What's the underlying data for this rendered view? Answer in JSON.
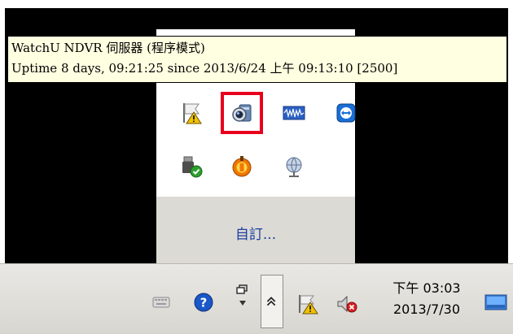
{
  "tooltip": {
    "line1": "WatchU NDVR 伺服器 (程序模式)",
    "line2": "Uptime 8 days, 09:21:25 since 2013/6/24 上午 09:13:10 [2500]"
  },
  "overflow_panel": {
    "customize_label": "自訂..."
  },
  "tray_icons": [
    "flag-warning-icon",
    "webcam-icon",
    "audio-wave-icon",
    "teamviewer-icon",
    "usb-safely-remove-icon",
    "orange-app-icon",
    "network-globe-icon"
  ],
  "taskbar": {
    "time": "下午 03:03",
    "date": "2013/7/30"
  },
  "colors": {
    "highlight": "#e8001c",
    "tooltip_bg": "#ffffe1",
    "link": "#1b3ea0"
  }
}
